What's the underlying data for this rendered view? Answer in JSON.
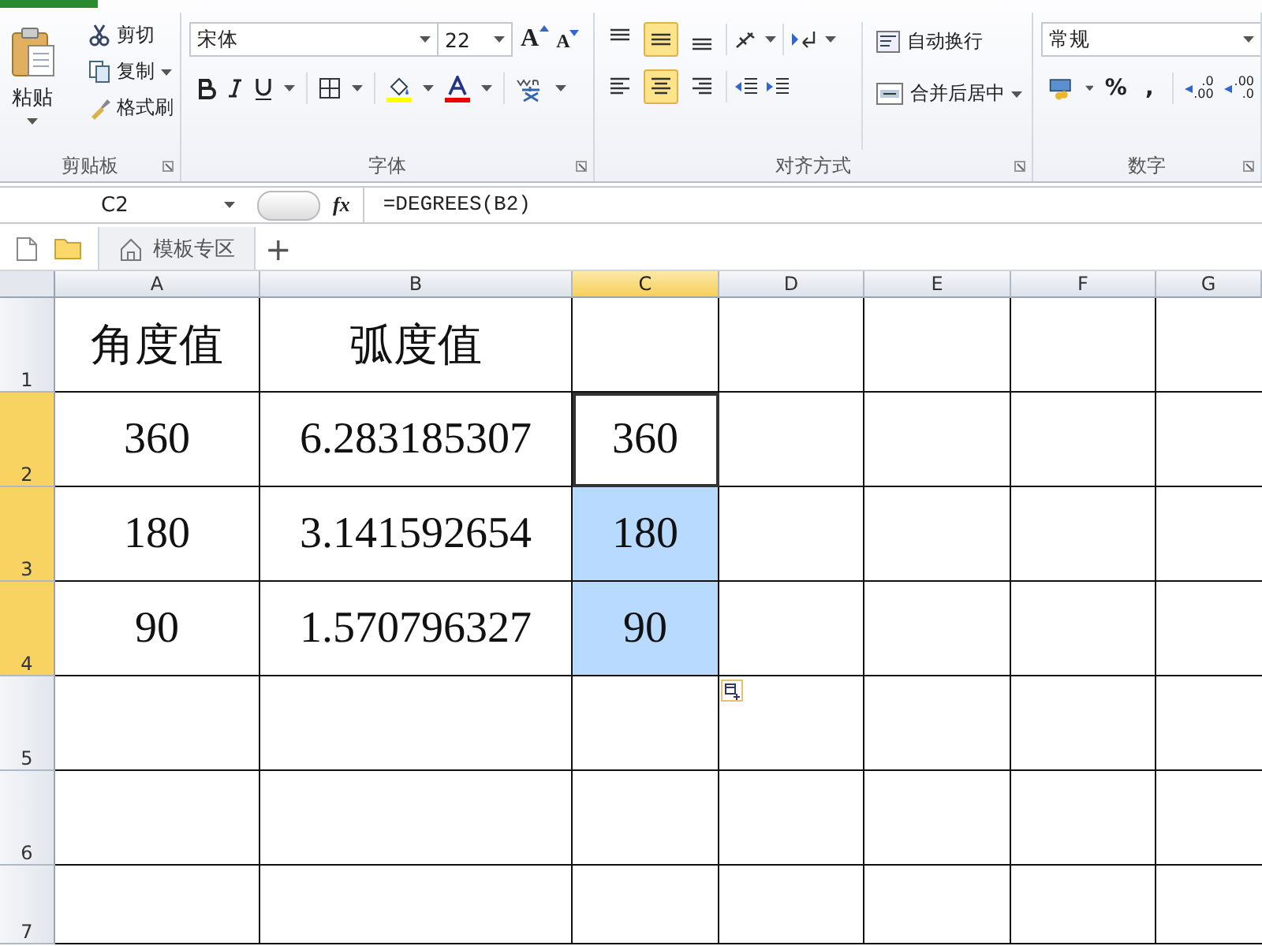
{
  "ribbon": {
    "clipboard": {
      "label": "剪贴板",
      "paste": "粘贴",
      "actions": [
        {
          "label": "剪切",
          "kind": "cut",
          "dropdown": false
        },
        {
          "label": "复制",
          "kind": "copy",
          "dropdown": true
        },
        {
          "label": "格式刷",
          "kind": "brush",
          "dropdown": false
        }
      ]
    },
    "font": {
      "label": "字体",
      "font_name": "宋体",
      "font_size": "22",
      "grow_font": "A",
      "shrink_font": "A"
    },
    "alignment": {
      "label": "对齐方式",
      "vertical": [
        {
          "kind": "top",
          "selected": false
        },
        {
          "kind": "middle",
          "selected": true
        },
        {
          "kind": "bottom",
          "selected": false
        }
      ],
      "horizontal": [
        {
          "kind": "left",
          "selected": false
        },
        {
          "kind": "center",
          "selected": true
        },
        {
          "kind": "right",
          "selected": false
        }
      ],
      "wrap": "自动换行",
      "merge": "合并后居中"
    },
    "number": {
      "label": "数字",
      "format": "常规",
      "percent": "%",
      "comma": ",",
      "increase_decimal": [
        ".0",
        ".00"
      ],
      "decrease_decimal": [
        ".00",
        ".0"
      ]
    }
  },
  "formula_bar": {
    "name_box": "C2",
    "function_label": "fx",
    "formula": "=DEGREES(B2)"
  },
  "doc_tabs": [
    {
      "label": "模板专区"
    }
  ],
  "new_tab": "+",
  "sheet": {
    "columns": [
      {
        "label": "A",
        "selected": false
      },
      {
        "label": "B",
        "selected": false
      },
      {
        "label": "C",
        "selected": true
      },
      {
        "label": "D",
        "selected": false
      },
      {
        "label": "E",
        "selected": false
      },
      {
        "label": "F",
        "selected": false
      },
      {
        "label": "G",
        "selected": false
      }
    ],
    "rows": [
      {
        "header": "1",
        "selected": false,
        "cells": [
          {
            "text": "角度值",
            "selected": false,
            "active": false
          },
          {
            "text": "弧度值",
            "selected": false,
            "active": false
          }
        ]
      },
      {
        "header": "2",
        "selected": true,
        "cells": [
          {
            "text": "360",
            "selected": false,
            "active": false
          },
          {
            "text": "6.283185307",
            "selected": false,
            "active": false
          },
          {
            "text": "360",
            "selected": true,
            "active": true
          }
        ]
      },
      {
        "header": "3",
        "selected": true,
        "cells": [
          {
            "text": "180",
            "selected": false,
            "active": false
          },
          {
            "text": "3.141592654",
            "selected": false,
            "active": false
          },
          {
            "text": "180",
            "selected": true,
            "active": false
          }
        ]
      },
      {
        "header": "4",
        "selected": true,
        "cells": [
          {
            "text": "90",
            "selected": false,
            "active": false
          },
          {
            "text": "1.570796327",
            "selected": false,
            "active": false
          },
          {
            "text": "90",
            "selected": true,
            "active": false
          }
        ]
      },
      {
        "header": "5",
        "selected": false
      },
      {
        "header": "6",
        "selected": false
      },
      {
        "header": "7",
        "selected": false
      }
    ]
  }
}
